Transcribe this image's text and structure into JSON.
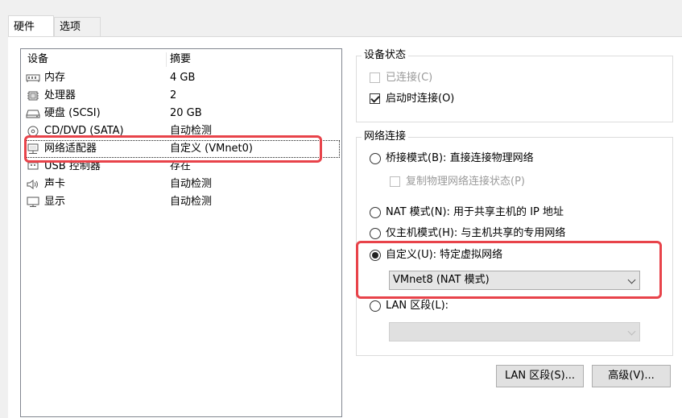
{
  "tabs": [
    {
      "label": "硬件",
      "active": true
    },
    {
      "label": "选项",
      "active": false
    }
  ],
  "device_list": {
    "headers": {
      "device": "设备",
      "summary": "摘要"
    },
    "rows": [
      {
        "icon": "memory-icon",
        "device": "内存",
        "summary": "4 GB"
      },
      {
        "icon": "processor-icon",
        "device": "处理器",
        "summary": "2"
      },
      {
        "icon": "hard-disk-icon",
        "device": "硬盘 (SCSI)",
        "summary": "20 GB"
      },
      {
        "icon": "cd-dvd-icon",
        "device": "CD/DVD (SATA)",
        "summary": "自动检测"
      },
      {
        "icon": "network-adapter-icon",
        "device": "网络适配器",
        "summary": "自定义 (VMnet0)",
        "selected": true
      },
      {
        "icon": "usb-icon",
        "device": "USB 控制器",
        "summary": "存在"
      },
      {
        "icon": "sound-card-icon",
        "device": "声卡",
        "summary": "自动检测"
      },
      {
        "icon": "display-icon",
        "device": "显示",
        "summary": "自动检测"
      }
    ]
  },
  "device_status": {
    "title": "设备状态",
    "connected": {
      "label": "已连接(C)",
      "checked": false,
      "enabled": false
    },
    "connect_at_power_on": {
      "label": "启动时连接(O)",
      "checked": true,
      "enabled": true
    }
  },
  "network_connection": {
    "title": "网络连接",
    "bridged": {
      "label": "桥接模式(B): 直接连接物理网络",
      "checked": false
    },
    "replicate": {
      "label": "复制物理网络连接状态(P)",
      "checked": false,
      "enabled": false
    },
    "nat": {
      "label": "NAT 模式(N): 用于共享主机的 IP 地址",
      "checked": false
    },
    "host_only": {
      "label": "仅主机模式(H): 与主机共享的专用网络",
      "checked": false
    },
    "custom": {
      "label": "自定义(U): 特定虚拟网络",
      "checked": true
    },
    "custom_select": {
      "value": "VMnet8 (NAT 模式)"
    },
    "lan_segment": {
      "label": "LAN 区段(L):",
      "checked": false
    },
    "lan_select": {
      "value": "",
      "enabled": false
    }
  },
  "buttons": {
    "lan_segments": "LAN 区段(S)...",
    "advanced": "高级(V)..."
  },
  "colors": {
    "highlight_border": "#e8434a"
  }
}
